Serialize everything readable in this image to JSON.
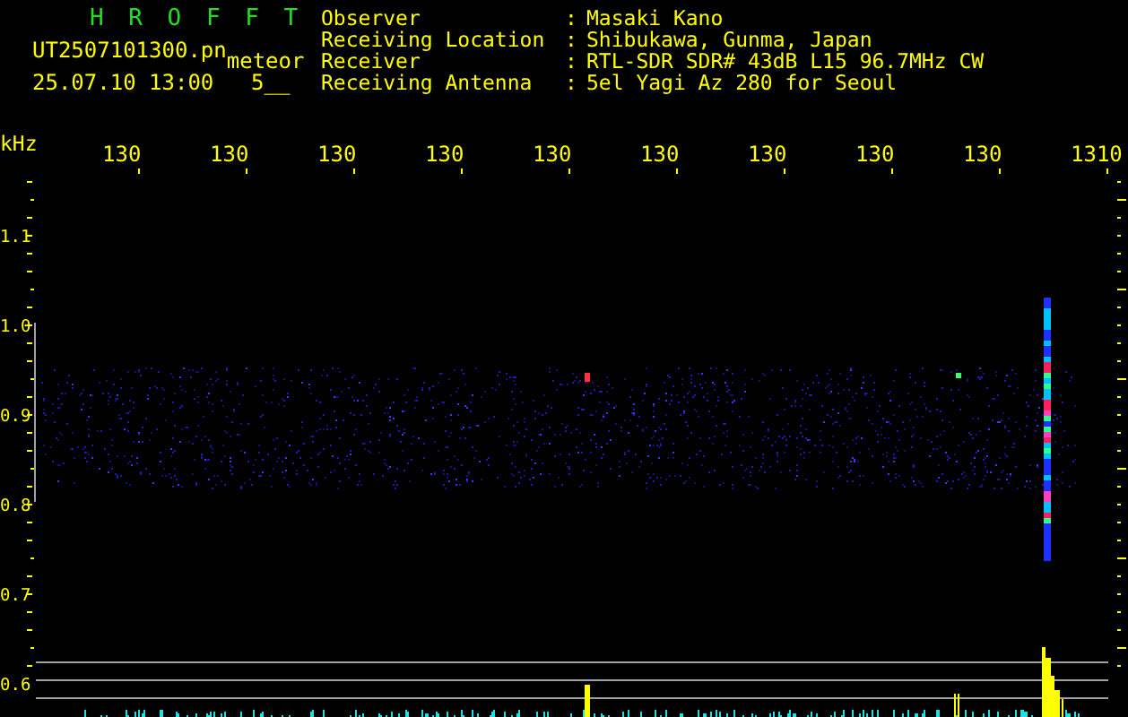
{
  "header": {
    "title": "H R O F F T",
    "file_name": "UT2507101300.pn",
    "event_type": "meteor",
    "timestamp": "25.07.10 13:00",
    "count": "5__"
  },
  "info": [
    {
      "label": "Observer",
      "colon": ":",
      "value": "Masaki Kano"
    },
    {
      "label": "Receiving Location",
      "colon": ":",
      "value": "Shibukawa, Gunma, Japan"
    },
    {
      "label": "Receiver",
      "colon": ":",
      "value": "RTL-SDR SDR# 43dB L15 96.7MHz CW"
    },
    {
      "label": "Receiving Antenna",
      "colon": ":",
      "value": "5el Yagi Az 280 for Seoul"
    }
  ],
  "frequency_axis": {
    "unit": "kHz",
    "labels": [
      "130",
      "130",
      "130",
      "130",
      "130",
      "130",
      "130",
      "130",
      "130",
      "1310"
    ]
  },
  "time_axis": {
    "labels": [
      "1.1",
      "1.0",
      "0.9",
      "0.8",
      "0.7",
      "0.6"
    ]
  }
}
